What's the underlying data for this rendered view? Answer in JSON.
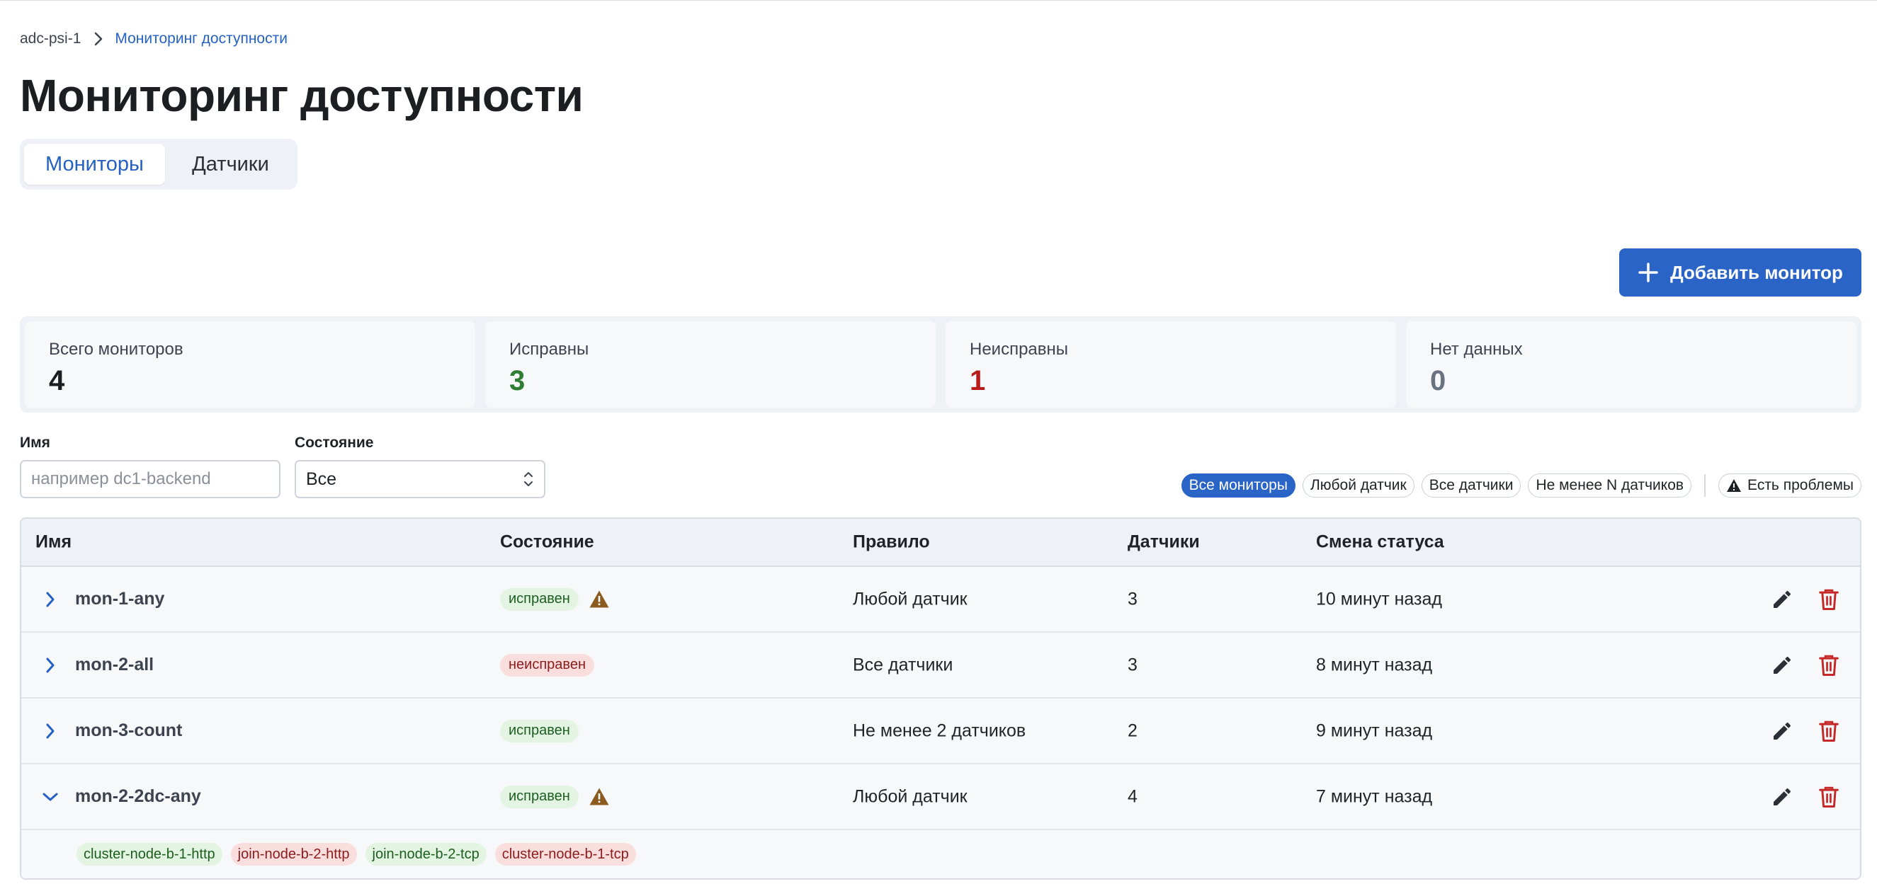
{
  "breadcrumb": {
    "root": "adc-psi-1",
    "current": "Мониторинг доступности"
  },
  "page_title": "Мониторинг доступности",
  "tabs": [
    {
      "label": "Мониторы",
      "active": true
    },
    {
      "label": "Датчики",
      "active": false
    }
  ],
  "add_button": {
    "label": "Добавить монитор"
  },
  "stats": [
    {
      "label": "Всего мониторов",
      "value": "4",
      "color": "#1c1e21"
    },
    {
      "label": "Исправны",
      "value": "3",
      "color": "#2e7d32"
    },
    {
      "label": "Неисправны",
      "value": "1",
      "color": "#b71c1c"
    },
    {
      "label": "Нет данных",
      "value": "0",
      "color": "#6b7280"
    }
  ],
  "filters": {
    "name_label": "Имя",
    "name_placeholder": "например dc1-backend",
    "name_value": "",
    "state_label": "Состояние",
    "state_value": "Все",
    "chips": [
      "Все мониторы",
      "Любой датчик",
      "Все датчики",
      "Не менее N датчиков"
    ],
    "active_chip": 0,
    "problems_chip": "Есть проблемы"
  },
  "table": {
    "headers": {
      "name": "Имя",
      "state": "Состояние",
      "rule": "Правило",
      "sensors": "Датчики",
      "change": "Смена статуса"
    },
    "rows": [
      {
        "name": "mon-1-any",
        "state": "исправен",
        "state_kind": "ok",
        "warning": true,
        "rule": "Любой датчик",
        "sensors": "3",
        "change": "10 минут назад",
        "expanded": false
      },
      {
        "name": "mon-2-all",
        "state": "неисправен",
        "state_kind": "bad",
        "warning": false,
        "rule": "Все датчики",
        "sensors": "3",
        "change": "8 минут назад",
        "expanded": false
      },
      {
        "name": "mon-3-count",
        "state": "исправен",
        "state_kind": "ok",
        "warning": false,
        "rule": "Не менее 2 датчиков",
        "sensors": "2",
        "change": "9 минут назад",
        "expanded": false
      },
      {
        "name": "mon-2-2dc-any",
        "state": "исправен",
        "state_kind": "ok",
        "warning": true,
        "rule": "Любой датчик",
        "sensors": "4",
        "change": "7 минут назад",
        "expanded": true
      }
    ],
    "expanded_sensors": [
      {
        "name": "cluster-node-b-1-http",
        "kind": "ok"
      },
      {
        "name": "join-node-b-2-http",
        "kind": "bad"
      },
      {
        "name": "join-node-b-2-tcp",
        "kind": "ok"
      },
      {
        "name": "cluster-node-b-1-tcp",
        "kind": "bad"
      }
    ]
  },
  "colors": {
    "accent": "#2a64c7",
    "ok_text": "#1c5e1f",
    "bad_text": "#8a1c1c",
    "warn": "#8a5a1e",
    "delete": "#c62828"
  }
}
